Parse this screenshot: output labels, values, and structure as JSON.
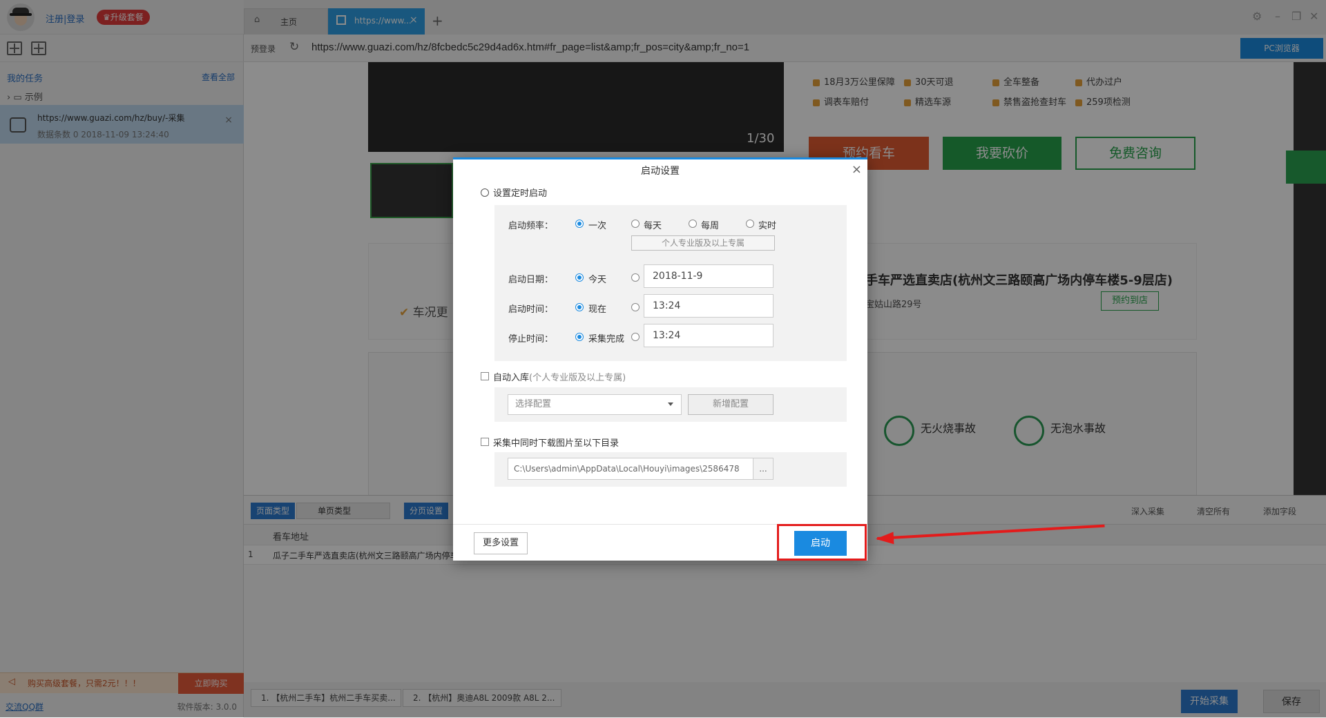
{
  "sidebar": {
    "login": "注册|登录",
    "upgrade": "♛升级套餐",
    "my_tasks": "我的任务",
    "view_all": "查看全部",
    "example_folder": "示例",
    "task": {
      "url": "https://www.guazi.com/hz/buy/-采集",
      "meta": "数据条数  0          2018-11-09 13:24:40"
    },
    "buy_text": "购买高级套餐，只需2元！！！",
    "buy_button": "立即购买",
    "qq_group": "交流QQ群",
    "version": "软件版本: 3.0.0"
  },
  "tabs": {
    "home": "主页",
    "active": "https://www...",
    "add": "+"
  },
  "addressbar": {
    "prelogin": "预登录",
    "url": "https://www.guazi.com/hz/8fcbedc5c29d4ad6x.htm#fr_page=list&amp;fr_pos=city&amp;fr_no=1",
    "browser_mode": "PC浏览器"
  },
  "web": {
    "photo_counter": "1/30",
    "features": [
      "18月3万公里保障",
      "30天可退",
      "全车整备",
      "代办过户",
      "调表车赔付",
      "精选车源",
      "禁售盗抢查封车",
      "259项检测"
    ],
    "book_button": "预约看车",
    "bargain_button": "我要砍价",
    "consult_button": "免费咨询",
    "store_name": "手车严选直卖店(杭州文三路颐高广场内停车楼5-9层店)",
    "store_addr": "宝姑山路29号",
    "store_button": "预约到店",
    "car_condition": "车况更",
    "no_fire": "无火烧事故",
    "no_flood": "无泡水事故"
  },
  "bottom": {
    "page_type_label": "页面类型",
    "page_type_value": "单页类型",
    "pagination": "分页设置",
    "deep_collect": "深入采集",
    "clear_all": "清空所有",
    "add_field": "添加字段",
    "column_header": "看车地址",
    "rows": [
      {
        "num": "1",
        "text": "瓜子二手车严选直卖店(杭州文三路颐高广场内停车"
      }
    ],
    "tabs": [
      "1. 【杭州二手车】杭州二手车买卖...",
      "2. 【杭州】奥迪A8L 2009款 A8L 2..."
    ],
    "start_collect": "开始采集",
    "save": "保存"
  },
  "dialog": {
    "title": "启动设置",
    "close": "×",
    "scheduled_start": "设置定时启动",
    "frequency_label": "启动频率：",
    "freq_once": "一次",
    "freq_daily": "每天",
    "freq_weekly": "每周",
    "freq_realtime": "实时",
    "pro_only": "个人专业版及以上专属",
    "date_label": "启动日期：",
    "date_today": "今天",
    "date_value": "2018-11-9",
    "time_label": "启动时间：",
    "time_now": "现在",
    "time_value": "13:24",
    "stop_label": "停止时间：",
    "stop_done": "采集完成",
    "stop_value": "13:24",
    "auto_store": "自动入库",
    "auto_store_note": "(个人专业版及以上专属)",
    "select_config": "选择配置",
    "new_config": "新增配置",
    "download_images": "采集中同时下载图片至以下目录",
    "image_dir": "C:\\Users\\admin\\AppData\\Local\\Houyi\\images\\2586478",
    "browse": "...",
    "more_settings": "更多设置",
    "start": "启动"
  },
  "colors": {
    "accent": "#1a8ae0",
    "highlight": "#e31b1b",
    "green": "#27a34c"
  }
}
